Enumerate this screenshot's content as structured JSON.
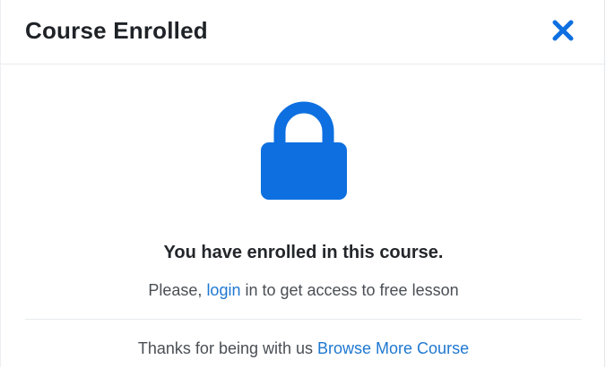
{
  "modal": {
    "title": "Course Enrolled",
    "close_icon": "close-icon",
    "lock_icon": "lock-icon",
    "headline": "You have enrolled in this course.",
    "subline": {
      "prefix": "Please, ",
      "link_label": "login",
      "suffix": " in to get access to free lesson"
    },
    "footer": {
      "prefix": "Thanks for being with us ",
      "link_label": "Browse More Course"
    }
  },
  "colors": {
    "accent": "#0d6fe0",
    "link": "#1f78d1",
    "title_text": "#1f2327",
    "body_text": "#4a4f55",
    "divider": "#e8ebee"
  }
}
